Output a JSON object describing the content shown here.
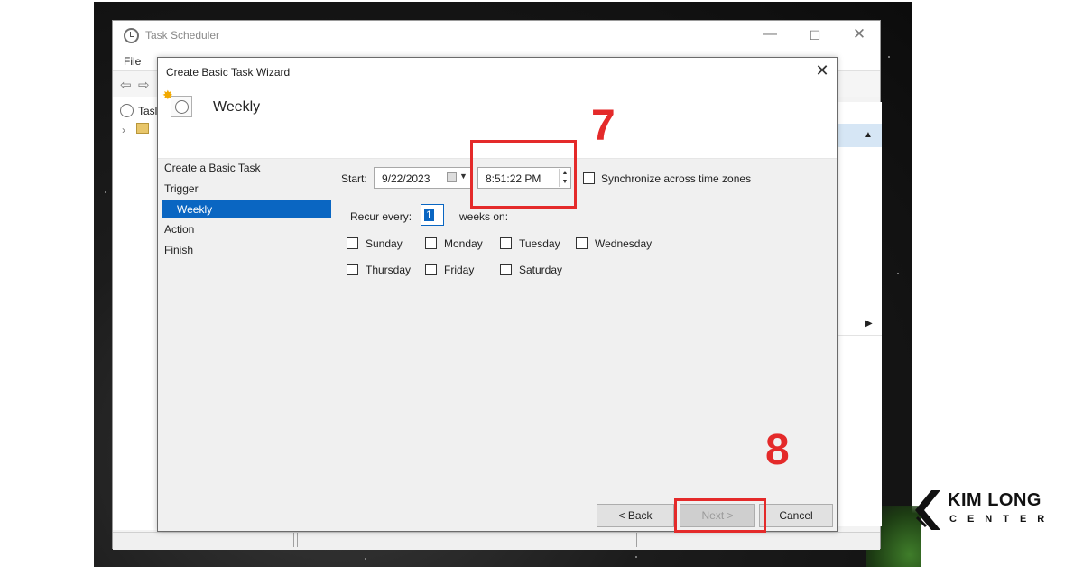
{
  "main_window": {
    "title": "Task Scheduler",
    "controls": {
      "minimize": "—",
      "maximize": "☐",
      "close": "✕"
    },
    "menu": {
      "file": "File"
    },
    "tree": {
      "item_label": "Tasl"
    }
  },
  "wizard": {
    "title": "Create Basic Task Wizard",
    "close": "✕",
    "page_title": "Weekly",
    "steps": {
      "create": "Create a Basic Task",
      "trigger": "Trigger",
      "weekly": "Weekly",
      "action": "Action",
      "finish": "Finish"
    },
    "start_label": "Start:",
    "start_date": "9/22/2023",
    "start_time": "8:51:22 PM",
    "sync_label": "Synchronize across time zones",
    "recur_label": "Recur every:",
    "recur_value": "1",
    "weeks_label": "weeks on:",
    "days": {
      "sunday": "Sunday",
      "monday": "Monday",
      "tuesday": "Tuesday",
      "wednesday": "Wednesday",
      "thursday": "Thursday",
      "friday": "Friday",
      "saturday": "Saturday"
    },
    "buttons": {
      "back": "< Back",
      "next": "Next >",
      "cancel": "Cancel"
    }
  },
  "annotations": {
    "step_7": "7",
    "step_8": "8",
    "color": "#e42a2a"
  },
  "logo": {
    "name": "KIM LONG",
    "sub": "CENTER"
  },
  "colors": {
    "accent": "#0a66c2"
  }
}
